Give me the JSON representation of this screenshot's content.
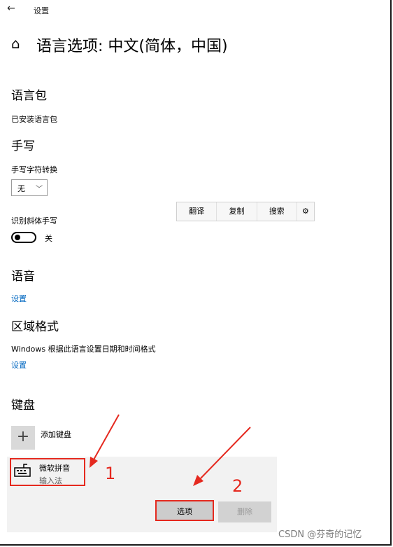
{
  "header": {
    "back_icon": "←",
    "app_title": "设置"
  },
  "page": {
    "home_icon": "⌂",
    "title": "语言选项: 中文(简体，中国)"
  },
  "language_pack": {
    "heading": "语言包",
    "status": "已安装语言包"
  },
  "handwriting": {
    "heading": "手写",
    "conversion_label": "手写字符转换",
    "conversion_value": "无",
    "italic_label": "识别斜体手写",
    "italic_state": "关"
  },
  "context_menu": {
    "items": [
      "翻译",
      "复制",
      "搜索"
    ]
  },
  "speech": {
    "heading": "语音",
    "settings_link": "设置"
  },
  "region": {
    "heading": "区域格式",
    "desc": "Windows 根据此语言设置日期和时间格式",
    "settings_link": "设置"
  },
  "keyboard": {
    "heading": "键盘",
    "add_label": "添加键盘",
    "item_name": "微软拼音",
    "item_type": "输入法",
    "options_button": "选项",
    "remove_button": "删除"
  },
  "annotations": {
    "label_1": "1",
    "label_2": "2",
    "accent": "#e5291f"
  },
  "watermark": "CSDN @芬奇的记忆"
}
